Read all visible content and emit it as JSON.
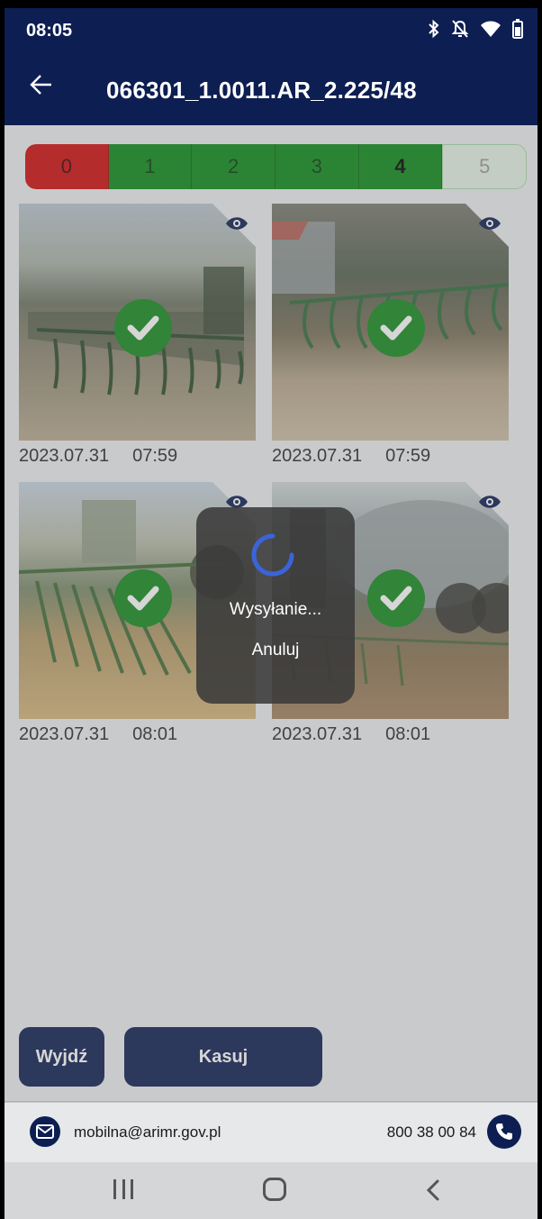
{
  "status_bar": {
    "time": "08:05"
  },
  "app_bar": {
    "title": "066301_1.0011.AR_2.225/48"
  },
  "stepper": {
    "steps": [
      {
        "label": "0",
        "state": "error",
        "color": "#d00c0c"
      },
      {
        "label": "1",
        "state": "done",
        "color": "#0b8a17"
      },
      {
        "label": "2",
        "state": "done",
        "color": "#0b8a17"
      },
      {
        "label": "3",
        "state": "done",
        "color": "#0b8a17"
      },
      {
        "label": "4",
        "state": "current",
        "color": "#0b8a17"
      },
      {
        "label": "5",
        "state": "pending",
        "color": "#e5f2e5"
      }
    ]
  },
  "photos": [
    {
      "date": "2023.07.31",
      "time": "07:59",
      "verified": true
    },
    {
      "date": "2023.07.31",
      "time": "07:59",
      "verified": true
    },
    {
      "date": "2023.07.31",
      "time": "08:01",
      "verified": true
    },
    {
      "date": "2023.07.31",
      "time": "08:01",
      "verified": true
    }
  ],
  "dialog": {
    "message": "Wysyłanie...",
    "cancel": "Anuluj"
  },
  "buttons": {
    "exit": "Wyjdź",
    "delete": "Kasuj"
  },
  "footer": {
    "email": "mobilna@arimr.gov.pl",
    "phone": "800 38 00 84"
  },
  "colors": {
    "primary": "#0d1e52",
    "success": "#0b8a17",
    "error": "#d00c0c",
    "spinner": "#3a64d8"
  }
}
